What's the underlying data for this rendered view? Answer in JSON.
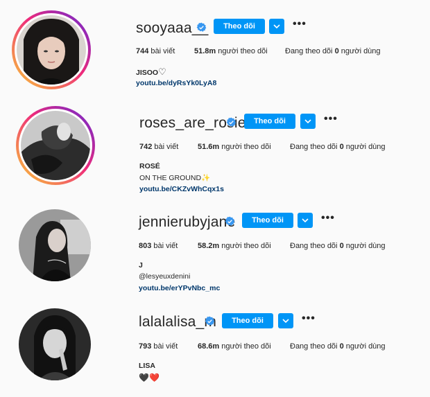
{
  "profiles": [
    {
      "username": "sooyaaa__",
      "follow_label": "Theo dõi",
      "posts_count": "744",
      "posts_label": "bài viết",
      "followers_count": "51.8m",
      "followers_label": "người theo dõi",
      "following_prefix": "Đang theo dõi",
      "following_count": "0",
      "following_suffix": "người dùng",
      "bio_name": "JISOO",
      "bio_emoji": "♡",
      "link": "youtu.be/dyRsYk0LyA8"
    },
    {
      "username": "roses_are_rosie",
      "follow_label": "Theo dõi",
      "posts_count": "742",
      "posts_label": "bài viết",
      "followers_count": "51.6m",
      "followers_label": "người theo dõi",
      "following_prefix": "Đang theo dõi",
      "following_count": "0",
      "following_suffix": "người dùng",
      "bio_name": "ROSÉ",
      "bio_line": "ON THE GROUND",
      "bio_emoji": "✨",
      "link": "youtu.be/CKZvWhCqx1s"
    },
    {
      "username": "jennierubyjane",
      "follow_label": "Theo dõi",
      "posts_count": "803",
      "posts_label": "bài viết",
      "followers_count": "58.2m",
      "followers_label": "người theo dõi",
      "following_prefix": "Đang theo dõi",
      "following_count": "0",
      "following_suffix": "người dùng",
      "bio_name": "J",
      "bio_line": "@lesyeuxdenini",
      "link": "youtu.be/erYPvNbc_mc"
    },
    {
      "username": "lalalalisa_m",
      "follow_label": "Theo dõi",
      "posts_count": "793",
      "posts_label": "bài viết",
      "followers_count": "68.6m",
      "followers_label": "người theo dõi",
      "following_prefix": "Đang theo dõi",
      "following_count": "0",
      "following_suffix": "người dùng",
      "bio_name": "LISA",
      "bio_emoji": "🖤❤️"
    }
  ],
  "icons": {
    "verified": "verified-badge-icon",
    "dropdown": "chevron-down-icon",
    "more": "more-options-icon"
  },
  "colors": {
    "follow_button": "#0095f6",
    "verified": "#3897f0",
    "link": "#00376b",
    "story_ring_start": "#f9ce34",
    "story_ring_end": "#6228d7"
  }
}
